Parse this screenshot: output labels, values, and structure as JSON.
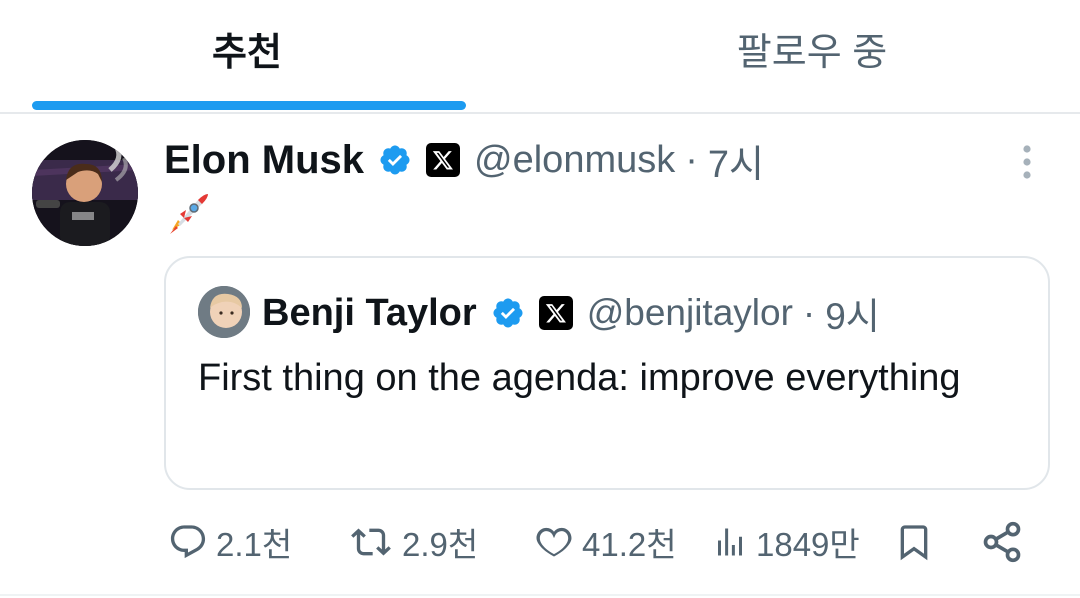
{
  "tabs": {
    "recommended": "추천",
    "following": "팔로우 중"
  },
  "post": {
    "author_name": "Elon Musk",
    "author_handle": "@elonmusk",
    "separator": "·",
    "time": "7시",
    "content_emoji": "rocket",
    "quote": {
      "author_name": "Benji Taylor",
      "author_handle": "@benjitaylor",
      "separator": "·",
      "time": "9시",
      "text": "First thing on the agenda: improve everything"
    },
    "actions": {
      "replies": "2.1천",
      "reposts": "2.9천",
      "likes": "41.2천",
      "views": "1849만"
    }
  },
  "colors": {
    "accent": "#1d9bf0",
    "text_primary": "#0f1419",
    "text_secondary": "#536471",
    "border": "#e1e6ea"
  },
  "icons": [
    "verified-badge-icon",
    "x-logo-icon",
    "more-vertical-icon",
    "rocket-emoji",
    "reply-icon",
    "repost-icon",
    "like-icon",
    "views-icon",
    "bookmark-icon",
    "share-icon"
  ]
}
